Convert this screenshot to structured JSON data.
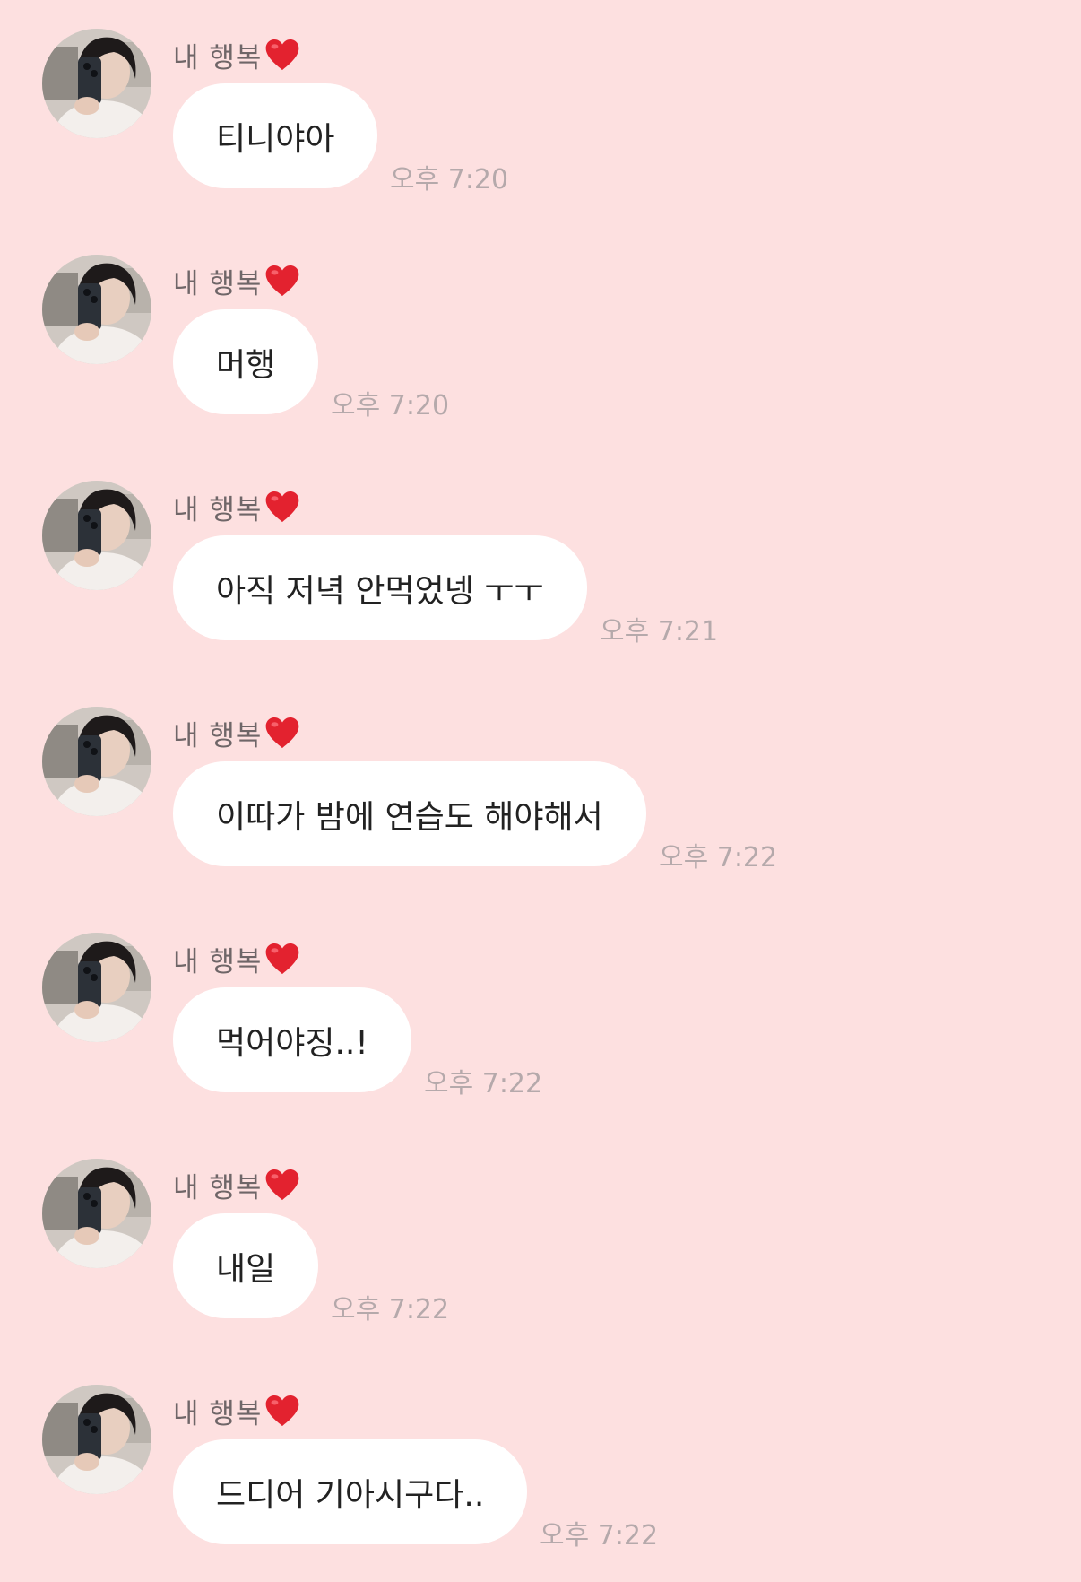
{
  "chat": {
    "sender_name": "내 행복",
    "messages": [
      {
        "text": "티니야아",
        "time": "오후 7:20"
      },
      {
        "text": "머행",
        "time": "오후 7:20"
      },
      {
        "text": "아직 저녁 안먹었넹 ㅜㅜ",
        "time": "오후 7:21"
      },
      {
        "text": "이따가 밤에 연습도 해야해서",
        "time": "오후 7:22"
      },
      {
        "text": "먹어야징..!",
        "time": "오후 7:22"
      },
      {
        "text": "내일",
        "time": "오후 7:22"
      },
      {
        "text": "드디어 기아시구다..",
        "time": "오후 7:22"
      }
    ]
  },
  "icons": {
    "avatar": "avatar-photo",
    "name_decoration": "red-heart-icon"
  },
  "colors": {
    "background": "#fde0e0",
    "bubble": "#ffffff",
    "heart": "#e3222f",
    "time_text": "#b5a9ab"
  }
}
